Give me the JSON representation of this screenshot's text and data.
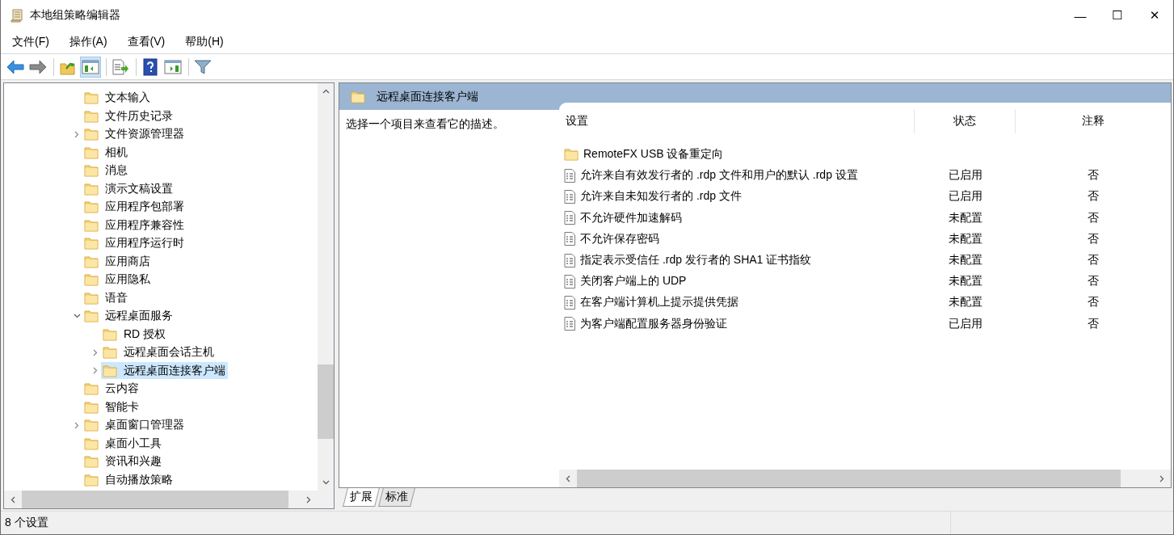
{
  "window": {
    "title": "本地组策略编辑器",
    "controls": [
      "—",
      "☐",
      "✕"
    ]
  },
  "menu": [
    {
      "label": "文件(F)"
    },
    {
      "label": "操作(A)"
    },
    {
      "label": "查看(V)"
    },
    {
      "label": "帮助(H)"
    }
  ],
  "toolbar": {
    "buttons": [
      {
        "pressed": false
      },
      {
        "pressed": false
      },
      {
        "pressed": false
      },
      {
        "pressed": true
      },
      {
        "pressed": false
      },
      {
        "pressed": false
      },
      {
        "pressed": false
      },
      {
        "pressed": false
      }
    ]
  },
  "tree": {
    "items": [
      {
        "label": "文本输入",
        "selected": false
      },
      {
        "label": "文件历史记录",
        "selected": false
      },
      {
        "label": "文件资源管理器",
        "expanded": false,
        "selected": false
      },
      {
        "label": "相机",
        "selected": false
      },
      {
        "label": "消息",
        "selected": false
      },
      {
        "label": "演示文稿设置",
        "selected": false
      },
      {
        "label": "应用程序包部署",
        "selected": false
      },
      {
        "label": "应用程序兼容性",
        "selected": false
      },
      {
        "label": "应用程序运行时",
        "selected": false
      },
      {
        "label": "应用商店",
        "selected": false
      },
      {
        "label": "应用隐私",
        "selected": false
      },
      {
        "label": "语音",
        "selected": false
      },
      {
        "label": "远程桌面服务",
        "expanded": true,
        "selected": false,
        "children": [
          {
            "label": "RD 授权",
            "selected": false
          },
          {
            "label": "远程桌面会话主机",
            "expanded": false,
            "selected": false
          },
          {
            "label": "远程桌面连接客户端",
            "expanded": false,
            "selected": true
          }
        ]
      },
      {
        "label": "云内容",
        "selected": false
      },
      {
        "label": "智能卡",
        "selected": false
      },
      {
        "label": "桌面窗口管理器",
        "expanded": false,
        "selected": false
      },
      {
        "label": "桌面小工具",
        "selected": false
      },
      {
        "label": "资讯和兴趣",
        "selected": false
      },
      {
        "label": "自动播放策略",
        "selected": false
      }
    ]
  },
  "detail": {
    "title": "远程桌面连接客户端",
    "description": "选择一个项目来查看它的描述。",
    "columns": [
      "设置",
      "状态",
      "注释"
    ],
    "rows": [
      {
        "kind": "folder",
        "name": "RemoteFX USB 设备重定向"
      },
      {
        "kind": "setting",
        "name": "允许来自有效发行者的 .rdp 文件和用户的默认 .rdp 设置",
        "state": "已启用",
        "comment": "否"
      },
      {
        "kind": "setting",
        "name": "允许来自未知发行者的 .rdp 文件",
        "state": "已启用",
        "comment": "否"
      },
      {
        "kind": "setting",
        "name": "不允许硬件加速解码",
        "state": "未配置",
        "comment": "否"
      },
      {
        "kind": "setting",
        "name": "不允许保存密码",
        "state": "未配置",
        "comment": "否"
      },
      {
        "kind": "setting",
        "name": "指定表示受信任 .rdp 发行者的 SHA1 证书指纹",
        "state": "未配置",
        "comment": "否"
      },
      {
        "kind": "setting",
        "name": "关闭客户端上的 UDP",
        "state": "未配置",
        "comment": "否"
      },
      {
        "kind": "setting",
        "name": "在客户端计算机上提示提供凭据",
        "state": "未配置",
        "comment": "否"
      },
      {
        "kind": "setting",
        "name": "为客户端配置服务器身份验证",
        "state": "已启用",
        "comment": "否"
      }
    ],
    "tabs": [
      {
        "label": "扩展",
        "selected": true
      },
      {
        "label": "标准",
        "selected": false
      }
    ]
  },
  "status_bar": {
    "text": "8 个设置"
  }
}
